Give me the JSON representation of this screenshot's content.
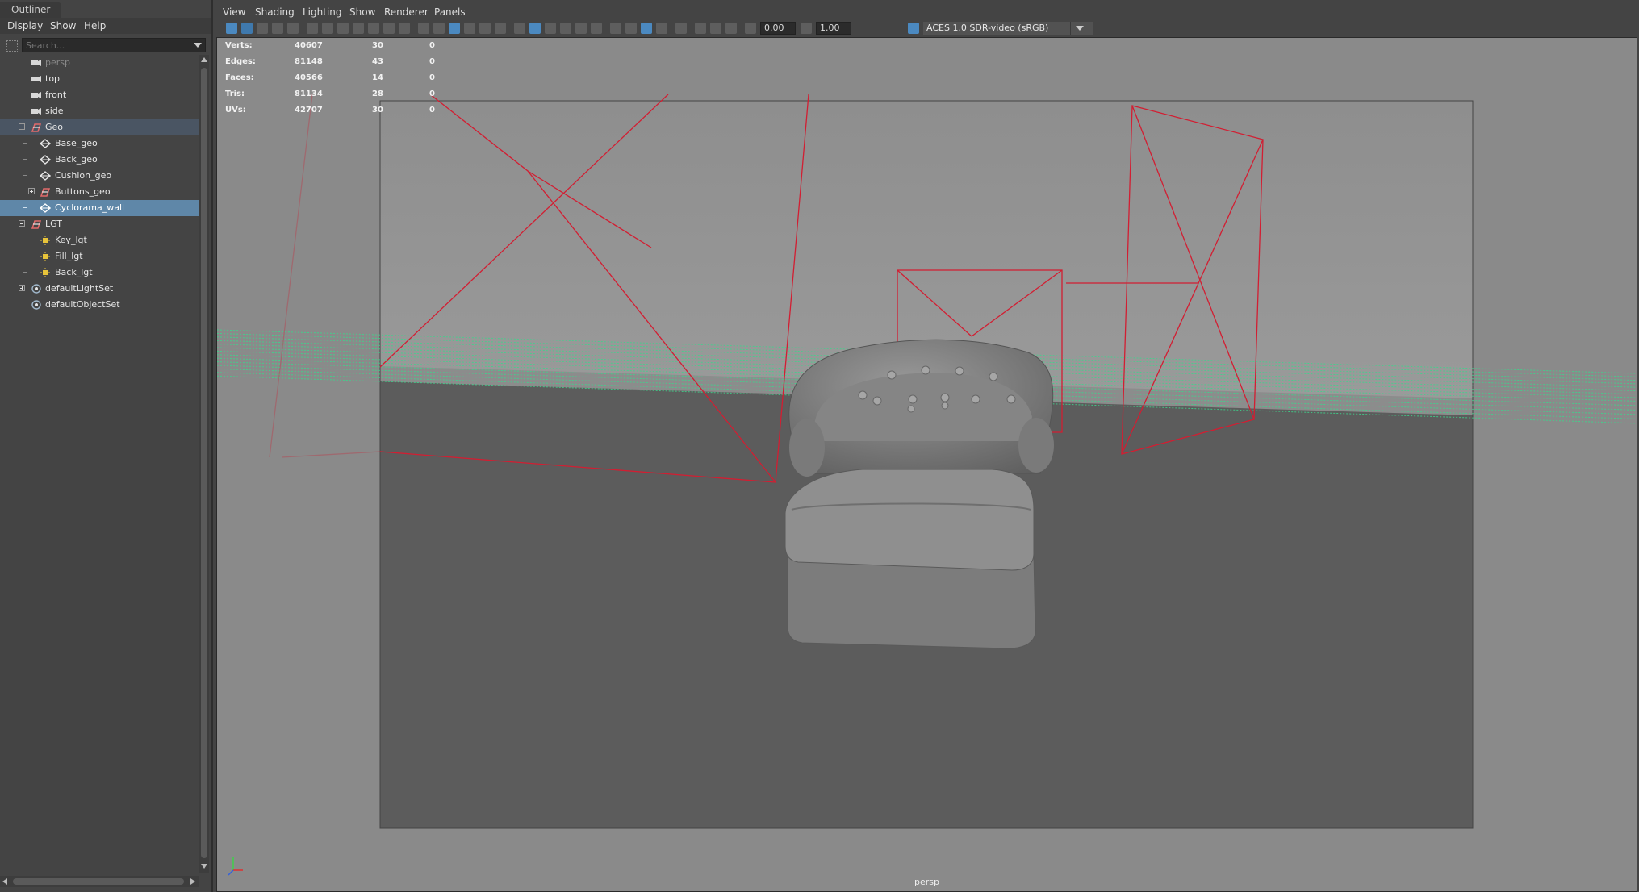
{
  "outliner": {
    "tab_label": "Outliner",
    "menu": [
      "Display",
      "Show",
      "Help"
    ],
    "search_placeholder": "Search...",
    "items": [
      {
        "label": "persp",
        "type": "camera"
      },
      {
        "label": "top",
        "type": "camera"
      },
      {
        "label": "front",
        "type": "camera"
      },
      {
        "label": "side",
        "type": "camera"
      },
      {
        "label": "Geo",
        "type": "group"
      },
      {
        "label": "Base_geo",
        "type": "mesh"
      },
      {
        "label": "Back_geo",
        "type": "mesh"
      },
      {
        "label": "Cushion_geo",
        "type": "mesh"
      },
      {
        "label": "Buttons_geo",
        "type": "group"
      },
      {
        "label": "Cyclorama_wall",
        "type": "mesh"
      },
      {
        "label": "LGT",
        "type": "group"
      },
      {
        "label": "Key_lgt",
        "type": "light"
      },
      {
        "label": "Fill_lgt",
        "type": "light"
      },
      {
        "label": "Back_lgt",
        "type": "light"
      },
      {
        "label": "defaultLightSet",
        "type": "set"
      },
      {
        "label": "defaultObjectSet",
        "type": "set"
      }
    ],
    "selected_item": "Cyclorama_wall"
  },
  "viewport": {
    "menu": [
      "View",
      "Shading",
      "Lighting",
      "Show",
      "Renderer",
      "Panels"
    ],
    "exposure": "0.00",
    "gamma": "1.00",
    "color_space": "ACES 1.0 SDR-video (sRGB)",
    "camera": "persp",
    "hud": [
      {
        "label": "Verts:",
        "total": "40607",
        "selected": "30",
        "triangles": "0"
      },
      {
        "label": "Edges:",
        "total": "81148",
        "selected": "43",
        "triangles": "0"
      },
      {
        "label": "Faces:",
        "total": "40566",
        "selected": "14",
        "triangles": "0"
      },
      {
        "label": "Tris:",
        "total": "81134",
        "selected": "28",
        "triangles": "0"
      },
      {
        "label": "UVs:",
        "total": "42707",
        "selected": "30",
        "triangles": "0"
      }
    ]
  },
  "colors": {
    "selection_highlight": "#5f87a8",
    "group_row": "#4a5563",
    "light_wire": "#d21e32",
    "selected_wire": "#3dd68c",
    "viewport_bg": "#8c8c8c"
  }
}
